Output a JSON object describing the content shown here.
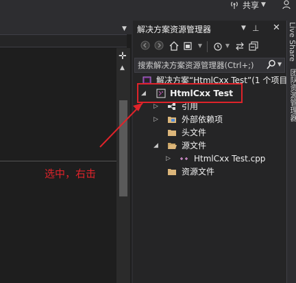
{
  "topbar": {
    "share_label": "共享",
    "share_icon": "broadcast-icon",
    "account_icon": "account-icon"
  },
  "solution_explorer": {
    "title": "解决方案资源管理器",
    "search_placeholder": "搜索解决方案资源管理器(Ctrl+;)",
    "solution_label": "解决方案“HtmlCxx Test”(1 个项目/",
    "project_label": "HtmlCxx Test",
    "items": [
      {
        "label": "引用",
        "icon": "references-icon"
      },
      {
        "label": "外部依赖项",
        "icon": "external-deps-icon"
      },
      {
        "label": "头文件",
        "icon": "folder-icon"
      },
      {
        "label": "源文件",
        "icon": "folder-open-icon"
      },
      {
        "label": "HtmlCxx Test.cpp",
        "icon": "cpp-file-icon"
      },
      {
        "label": "资源文件",
        "icon": "folder-icon"
      }
    ]
  },
  "right_strip": {
    "tab1": "Live Share",
    "tab2": "团队资源管理器"
  },
  "annotation": {
    "text": "选中，右击"
  },
  "colors": {
    "background": "#2d2d30",
    "panel": "#252526",
    "editor": "#1e1e1e",
    "annotation_red": "#e0232a",
    "folder_yellow": "#dcb67a",
    "cpp_purple": "#9b4f96"
  }
}
